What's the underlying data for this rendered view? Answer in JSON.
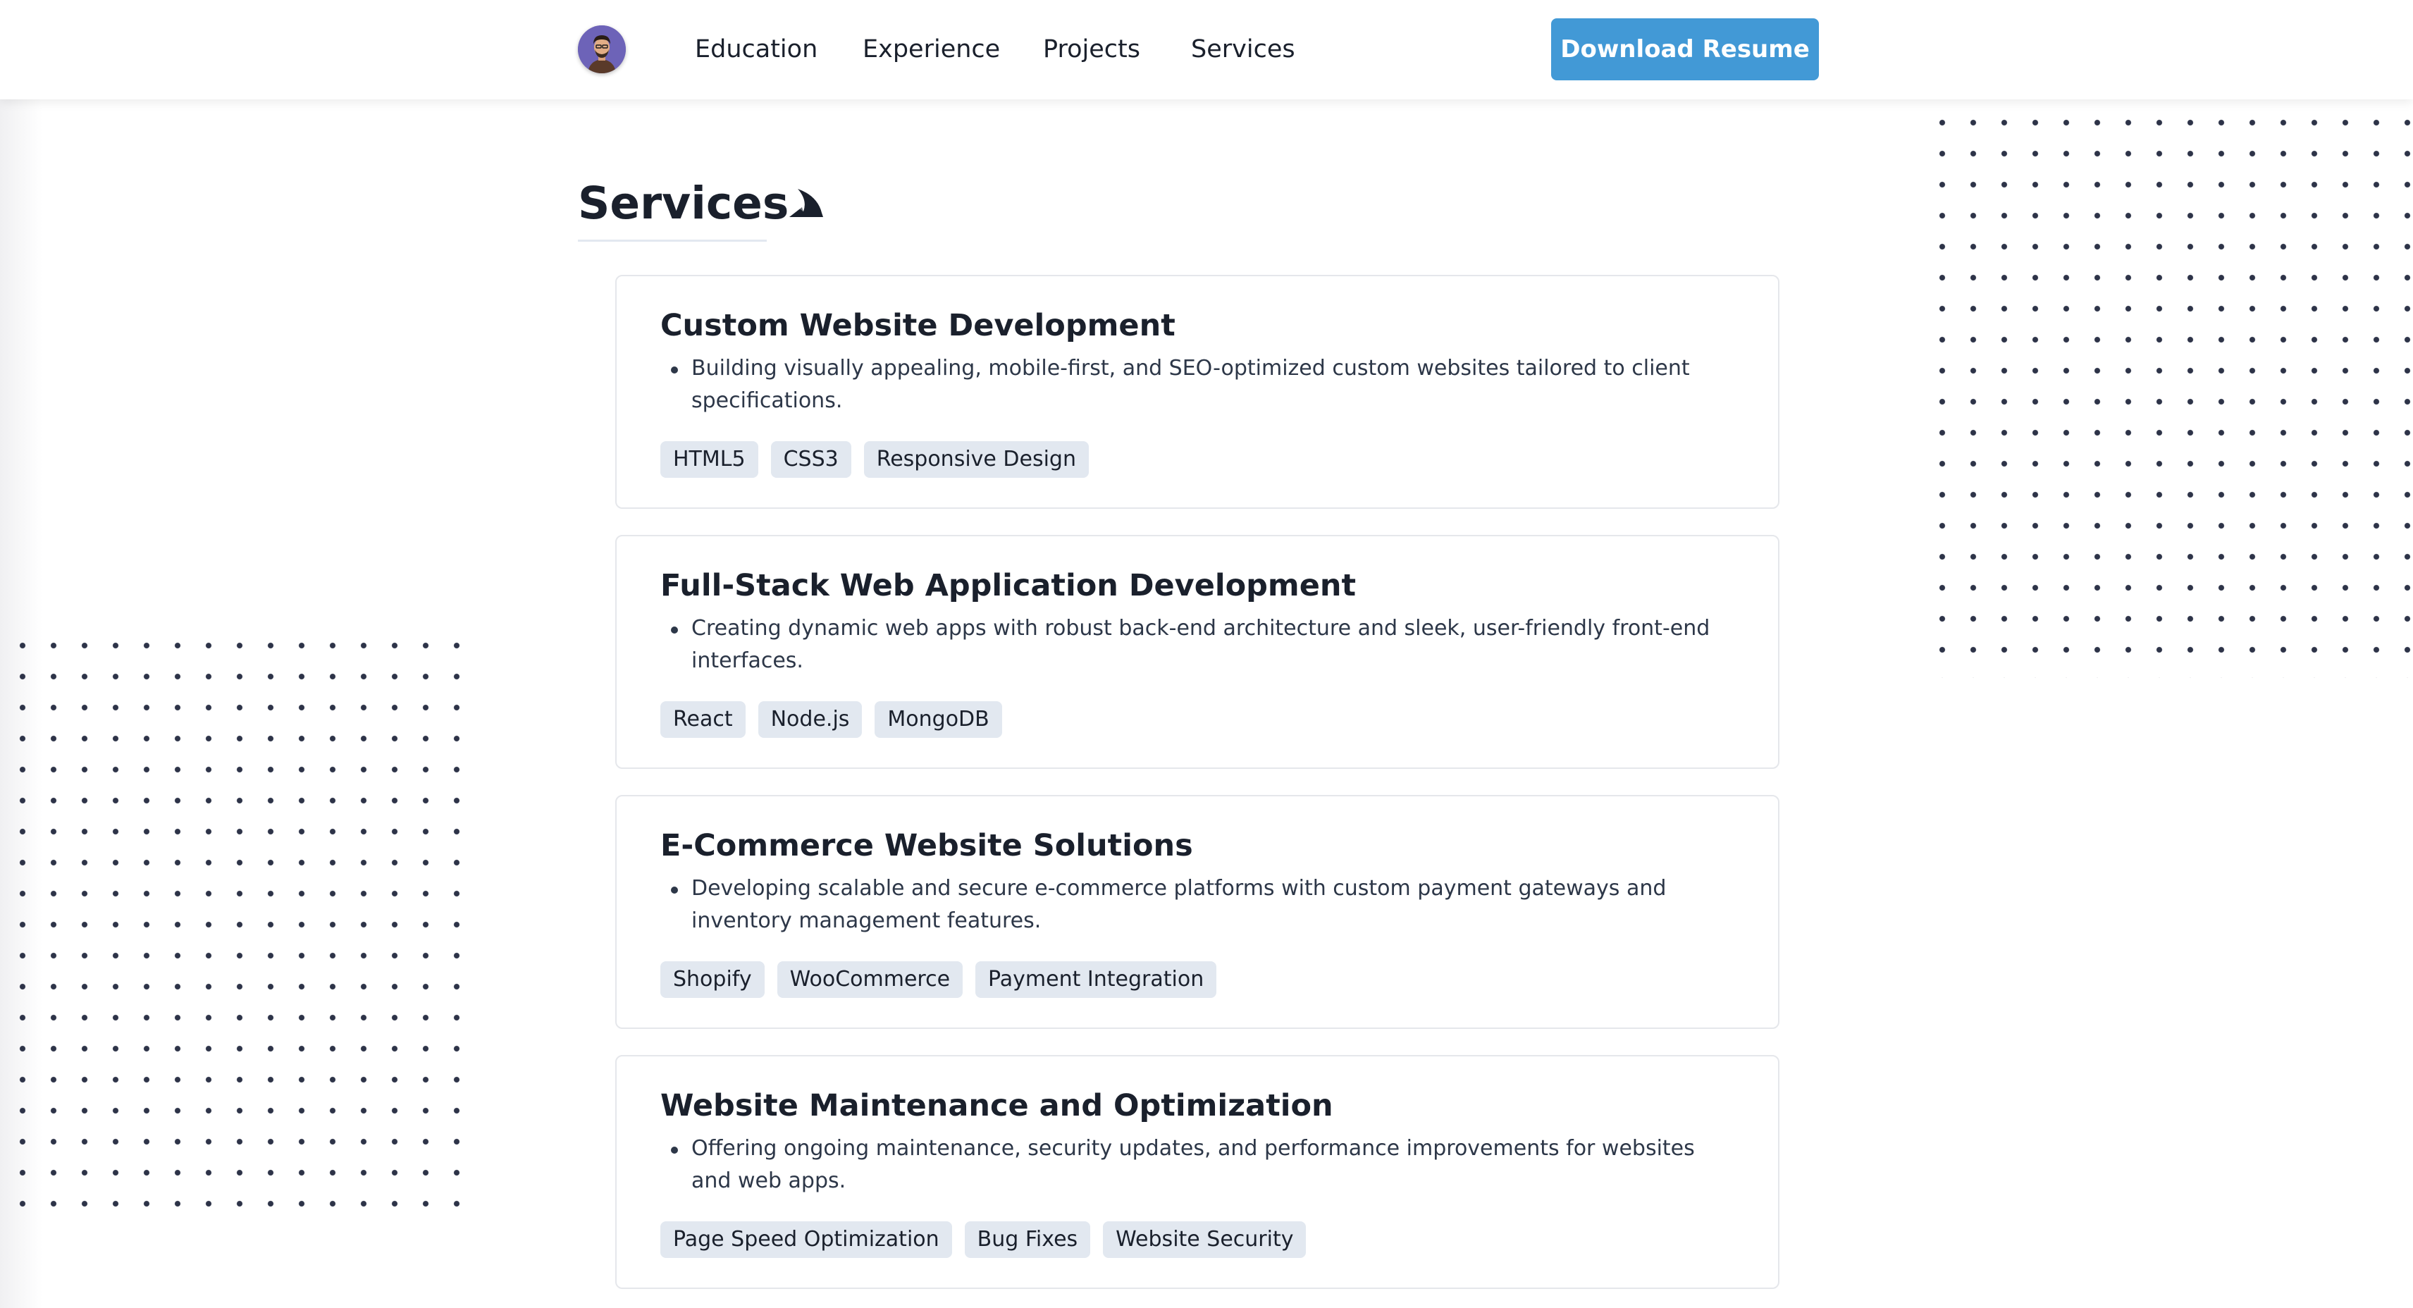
{
  "nav": {
    "items": [
      {
        "label": "Education"
      },
      {
        "label": "Experience"
      },
      {
        "label": "Projects"
      },
      {
        "label": "Services"
      }
    ],
    "download_label": "Download Resume"
  },
  "section": {
    "title": "Services"
  },
  "services": [
    {
      "title": "Custom Website Development",
      "description": "Building visually appealing, mobile-first, and SEO-optimized custom websites tailored to client specifications.",
      "tags": [
        "HTML5",
        "CSS3",
        "Responsive Design"
      ]
    },
    {
      "title": "Full-Stack Web Application Development",
      "description": "Creating dynamic web apps with robust back-end architecture and sleek, user-friendly front-end interfaces.",
      "tags": [
        "React",
        "Node.js",
        "MongoDB"
      ]
    },
    {
      "title": "E-Commerce Website Solutions",
      "description": "Developing scalable and secure e-commerce platforms with custom payment gateways and inventory management features.",
      "tags": [
        "Shopify",
        "WooCommerce",
        "Payment Integration"
      ]
    },
    {
      "title": "Website Maintenance and Optimization",
      "description": "Offering ongoing maintenance, security updates, and performance improvements for websites and web apps.",
      "tags": [
        "Page Speed Optimization",
        "Bug Fixes",
        "Website Security"
      ]
    }
  ],
  "colors": {
    "accent": "#4299d6",
    "tag_bg": "#e2e8f0",
    "dots": "#2d3348",
    "avatar_bg": "#6d63b8"
  },
  "icons": {
    "avatar": "developer-avatar",
    "section": "shark-fin-icon"
  }
}
